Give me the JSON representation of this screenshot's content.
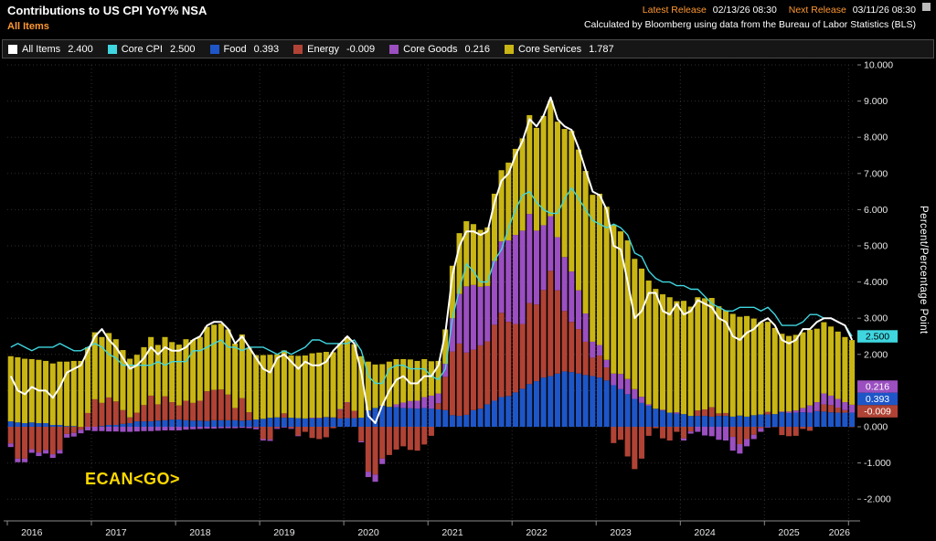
{
  "header": {
    "title": "Contributions to US CPI YoY% NSA",
    "subtitle": "All Items",
    "latest_release_label": "Latest Release",
    "latest_release_value": "02/13/26 08:30",
    "next_release_label": "Next Release",
    "next_release_value": "03/11/26 08:30",
    "source_note": "Calculated by Bloomberg using data from the Bureau of Labor Statistics (BLS)"
  },
  "annotation": "ECAN<GO>",
  "legend": {
    "items": [
      {
        "label": "All Items",
        "value": "2.400",
        "color": "#ffffff"
      },
      {
        "label": "Core CPI",
        "value": "2.500",
        "color": "#3fd6e0"
      },
      {
        "label": "Food",
        "value": "0.393",
        "color": "#1e56c8"
      },
      {
        "label": "Energy",
        "value": "-0.009",
        "color": "#b04335"
      },
      {
        "label": "Core Goods",
        "value": "0.216",
        "color": "#9b4fc0"
      },
      {
        "label": "Core Services",
        "value": "1.787",
        "color": "#c9b514"
      }
    ]
  },
  "chart_data": {
    "type": "bar",
    "subtype": "stacked-bars-with-line-overlays",
    "title": "Contributions to US CPI YoY% NSA",
    "ylabel": "Percent/Percentage Point",
    "start_year": 2016,
    "frequency": "monthly",
    "ylim": [
      -2.55,
      10.15
    ],
    "grid": "dotted",
    "y_ticks": [
      10,
      9,
      8,
      7,
      6,
      5,
      4,
      3,
      2,
      1,
      0,
      -1,
      -2
    ],
    "y_tick_labels": [
      "10.000",
      "9.000",
      "8.000",
      "7.000",
      "6.000",
      "5.000",
      "4.000",
      "3.000",
      "2.000",
      "1.000",
      "0.000",
      "-1.000",
      "-2.000"
    ],
    "x_tick_labels": [
      "2016",
      "2017",
      "2018",
      "2019",
      "2020",
      "2021",
      "2022",
      "2023",
      "2024",
      "2025",
      "2026"
    ],
    "series": [
      {
        "name": "Food",
        "color": "#1e56c8",
        "values": [
          0.15,
          0.12,
          0.1,
          0.12,
          0.1,
          0.1,
          0.05,
          0.05,
          0.02,
          0.02,
          0.0,
          0.0,
          0.0,
          0.02,
          0.05,
          0.05,
          0.08,
          0.1,
          0.15,
          0.15,
          0.15,
          0.17,
          0.18,
          0.2,
          0.2,
          0.18,
          0.17,
          0.17,
          0.16,
          0.18,
          0.18,
          0.18,
          0.18,
          0.17,
          0.18,
          0.2,
          0.22,
          0.25,
          0.26,
          0.25,
          0.25,
          0.24,
          0.23,
          0.23,
          0.23,
          0.26,
          0.25,
          0.23,
          0.24,
          0.24,
          0.25,
          0.45,
          0.52,
          0.58,
          0.55,
          0.54,
          0.52,
          0.51,
          0.5,
          0.52,
          0.5,
          0.48,
          0.46,
          0.32,
          0.3,
          0.33,
          0.46,
          0.5,
          0.62,
          0.72,
          0.82,
          0.85,
          0.95,
          1.05,
          1.18,
          1.26,
          1.36,
          1.4,
          1.47,
          1.53,
          1.51,
          1.47,
          1.43,
          1.4,
          1.36,
          1.28,
          1.15,
          1.04,
          0.9,
          0.77,
          0.66,
          0.58,
          0.5,
          0.45,
          0.39,
          0.36,
          0.35,
          0.3,
          0.3,
          0.3,
          0.28,
          0.3,
          0.3,
          0.28,
          0.31,
          0.28,
          0.32,
          0.34,
          0.34,
          0.35,
          0.4,
          0.38,
          0.39,
          0.4,
          0.39,
          0.43,
          0.42,
          0.4,
          0.39,
          0.39,
          0.393
        ]
      },
      {
        "name": "Energy",
        "color": "#b04335",
        "values": [
          -0.46,
          -0.88,
          -0.88,
          -0.62,
          -0.71,
          -0.64,
          -0.76,
          -0.64,
          -0.2,
          -0.17,
          -0.08,
          0.38,
          0.76,
          0.64,
          0.76,
          0.65,
          0.38,
          0.16,
          0.24,
          0.45,
          0.71,
          0.45,
          0.66,
          0.48,
          0.39,
          0.54,
          0.49,
          0.55,
          0.82,
          0.84,
          0.85,
          0.71,
          0.34,
          0.62,
          0.22,
          -0.02,
          -0.34,
          -0.35,
          -0.03,
          0.12,
          -0.04,
          -0.24,
          -0.14,
          -0.31,
          -0.34,
          -0.29,
          -0.04,
          0.24,
          0.43,
          0.2,
          -0.4,
          -1.24,
          -1.32,
          -0.88,
          -0.78,
          -0.63,
          -0.54,
          -0.64,
          -0.66,
          -0.49,
          -0.25,
          0.17,
          0.92,
          1.76,
          2.0,
          1.72,
          1.67,
          1.75,
          1.74,
          2.1,
          2.33,
          2.05,
          1.89,
          1.79,
          2.24,
          2.12,
          2.42,
          2.91,
          2.3,
          1.67,
          1.39,
          1.23,
          0.92,
          0.51,
          0.61,
          0.36,
          -0.45,
          -0.36,
          -0.82,
          -1.17,
          -0.88,
          -0.25,
          -0.04,
          -0.32,
          -0.38,
          -0.14,
          -0.32,
          -0.13,
          0.15,
          0.18,
          0.26,
          0.07,
          0.08,
          -0.28,
          -0.48,
          -0.34,
          -0.22,
          -0.04,
          0.07,
          -0.01,
          -0.23,
          -0.26,
          -0.25,
          -0.06,
          -0.11,
          0.01,
          0.2,
          0.2,
          0.14,
          0.07,
          -0.009
        ]
      },
      {
        "name": "Core Goods",
        "color": "#9b4fc0",
        "values": [
          -0.1,
          -0.1,
          -0.1,
          -0.1,
          -0.1,
          -0.1,
          -0.1,
          -0.1,
          -0.1,
          -0.1,
          -0.1,
          -0.1,
          -0.12,
          -0.12,
          -0.13,
          -0.13,
          -0.14,
          -0.14,
          -0.13,
          -0.12,
          -0.12,
          -0.11,
          -0.1,
          -0.1,
          -0.1,
          -0.08,
          -0.07,
          -0.06,
          -0.05,
          -0.05,
          -0.04,
          -0.04,
          -0.04,
          -0.03,
          -0.04,
          -0.05,
          -0.04,
          -0.04,
          -0.03,
          -0.02,
          -0.02,
          -0.02,
          0.0,
          0.02,
          0.02,
          0.01,
          0.01,
          0.02,
          0.01,
          0.0,
          -0.03,
          -0.15,
          -0.2,
          -0.15,
          0.0,
          0.08,
          0.15,
          0.2,
          0.22,
          0.3,
          0.36,
          0.27,
          0.36,
          0.92,
          1.37,
          1.83,
          1.79,
          1.62,
          1.53,
          1.76,
          1.97,
          2.25,
          2.46,
          2.58,
          2.46,
          2.04,
          1.79,
          1.51,
          1.47,
          1.49,
          1.39,
          1.07,
          0.78,
          0.44,
          0.29,
          0.21,
          0.32,
          0.42,
          0.42,
          0.27,
          0.17,
          0.04,
          0.0,
          0.02,
          0.0,
          0.04,
          -0.06,
          -0.06,
          -0.14,
          -0.24,
          -0.26,
          -0.36,
          -0.38,
          -0.38,
          -0.26,
          -0.2,
          -0.12,
          -0.1,
          -0.02,
          0.0,
          0.02,
          0.04,
          0.06,
          0.12,
          0.2,
          0.24,
          0.3,
          0.26,
          0.24,
          0.22,
          0.216
        ]
      },
      {
        "name": "Core Services",
        "color": "#c9b514",
        "values": [
          1.8,
          1.8,
          1.78,
          1.75,
          1.75,
          1.72,
          1.7,
          1.75,
          1.78,
          1.8,
          1.82,
          1.82,
          1.85,
          1.82,
          1.78,
          1.72,
          1.66,
          1.62,
          1.6,
          1.6,
          1.62,
          1.64,
          1.64,
          1.66,
          1.68,
          1.7,
          1.74,
          1.76,
          1.78,
          1.8,
          1.82,
          1.8,
          1.78,
          1.76,
          1.78,
          1.78,
          1.76,
          1.74,
          1.74,
          1.74,
          1.72,
          1.72,
          1.74,
          1.78,
          1.8,
          1.8,
          1.8,
          1.8,
          1.8,
          1.84,
          1.7,
          1.35,
          1.2,
          1.15,
          1.25,
          1.25,
          1.2,
          1.15,
          1.1,
          1.05,
          0.95,
          0.9,
          0.95,
          1.45,
          1.68,
          1.8,
          1.68,
          1.57,
          1.62,
          1.86,
          1.97,
          2.15,
          2.38,
          2.55,
          2.73,
          2.84,
          3.02,
          3.19,
          3.19,
          3.54,
          3.89,
          3.89,
          3.94,
          4.06,
          4.18,
          4.23,
          4.12,
          3.94,
          3.83,
          3.6,
          3.54,
          3.42,
          3.31,
          3.19,
          3.19,
          3.07,
          3.13,
          3.02,
          3.13,
          3.07,
          3.02,
          2.96,
          2.84,
          2.84,
          2.73,
          2.78,
          2.67,
          2.55,
          2.49,
          2.38,
          2.15,
          2.09,
          2.09,
          2.09,
          2.09,
          2.03,
          1.97,
          1.91,
          1.86,
          1.8,
          1.787
        ]
      }
    ],
    "lines": [
      {
        "name": "All Items",
        "color": "#ffffff",
        "values": [
          1.4,
          1.0,
          0.9,
          1.1,
          1.0,
          1.0,
          0.8,
          1.1,
          1.5,
          1.6,
          1.7,
          2.1,
          2.5,
          2.7,
          2.4,
          2.2,
          1.9,
          1.6,
          1.7,
          1.9,
          2.2,
          2.0,
          2.2,
          2.1,
          2.1,
          2.2,
          2.4,
          2.5,
          2.8,
          2.9,
          2.9,
          2.7,
          2.3,
          2.5,
          2.2,
          1.9,
          1.6,
          1.5,
          1.9,
          2.0,
          1.8,
          1.6,
          1.8,
          1.7,
          1.7,
          1.8,
          2.1,
          2.3,
          2.5,
          2.3,
          1.5,
          0.3,
          0.1,
          0.6,
          1.0,
          1.3,
          1.4,
          1.2,
          1.2,
          1.4,
          1.4,
          1.7,
          2.6,
          4.2,
          5.0,
          5.4,
          5.4,
          5.3,
          5.4,
          6.2,
          6.8,
          7.0,
          7.5,
          7.9,
          8.5,
          8.3,
          8.6,
          9.1,
          8.5,
          8.3,
          8.2,
          7.7,
          7.1,
          6.5,
          6.4,
          6.0,
          5.0,
          4.9,
          4.0,
          3.0,
          3.2,
          3.7,
          3.7,
          3.2,
          3.1,
          3.4,
          3.1,
          3.2,
          3.5,
          3.4,
          3.3,
          3.0,
          2.9,
          2.5,
          2.4,
          2.6,
          2.7,
          2.9,
          3.0,
          2.8,
          2.4,
          2.3,
          2.4,
          2.7,
          2.7,
          2.9,
          3.0,
          3.0,
          2.9,
          2.8,
          2.4
        ]
      },
      {
        "name": "Core CPI",
        "color": "#3fd6e0",
        "values": [
          2.2,
          2.3,
          2.2,
          2.1,
          2.2,
          2.2,
          2.2,
          2.3,
          2.2,
          2.1,
          2.1,
          2.2,
          2.3,
          2.2,
          2.0,
          1.9,
          1.7,
          1.7,
          1.7,
          1.7,
          1.7,
          1.8,
          1.7,
          1.8,
          1.8,
          1.8,
          2.1,
          2.1,
          2.2,
          2.3,
          2.4,
          2.2,
          2.2,
          2.1,
          2.2,
          2.2,
          2.2,
          2.1,
          2.0,
          2.1,
          2.0,
          2.1,
          2.2,
          2.4,
          2.4,
          2.3,
          2.3,
          2.3,
          2.3,
          2.4,
          2.1,
          1.4,
          1.2,
          1.2,
          1.6,
          1.7,
          1.7,
          1.6,
          1.6,
          1.6,
          1.4,
          1.3,
          1.6,
          3.0,
          3.8,
          4.5,
          4.3,
          4.0,
          4.0,
          4.6,
          4.9,
          5.5,
          6.0,
          6.4,
          6.5,
          6.2,
          6.0,
          5.9,
          5.9,
          6.3,
          6.6,
          6.3,
          6.0,
          5.7,
          5.6,
          5.5,
          5.6,
          5.5,
          5.3,
          4.8,
          4.7,
          4.3,
          4.1,
          4.0,
          4.0,
          3.9,
          3.9,
          3.8,
          3.8,
          3.6,
          3.4,
          3.3,
          3.2,
          3.2,
          3.3,
          3.3,
          3.3,
          3.2,
          3.3,
          3.1,
          2.8,
          2.8,
          2.8,
          2.9,
          3.1,
          3.1,
          3.0,
          3.0,
          2.9,
          2.8,
          2.5
        ]
      }
    ],
    "badges": [
      {
        "text": "2.500",
        "bg": "#3fd6e0",
        "fg": "#000000"
      },
      {
        "text": "0.216",
        "bg": "#9b4fc0",
        "fg": "#ffffff"
      },
      {
        "text": "0.393",
        "bg": "#1e56c8",
        "fg": "#ffffff"
      },
      {
        "text": "-0.009",
        "bg": "#b04335",
        "fg": "#ffffff"
      }
    ]
  }
}
